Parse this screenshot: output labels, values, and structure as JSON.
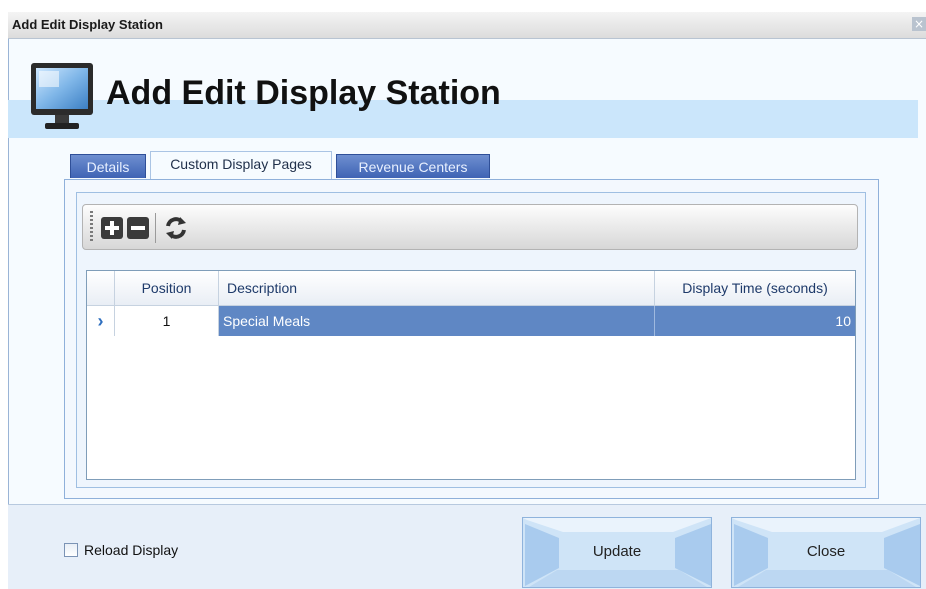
{
  "window": {
    "title": "Add Edit Display Station",
    "close_glyph": "×"
  },
  "header": {
    "icon": "monitor-icon",
    "title": "Add Edit Display Station"
  },
  "tabs": [
    {
      "label": "Details",
      "active": false
    },
    {
      "label": "Custom Display Pages",
      "active": true
    },
    {
      "label": "Revenue Centers",
      "active": false
    }
  ],
  "toolbar": {
    "buttons": [
      {
        "icon": "add-icon"
      },
      {
        "icon": "remove-icon"
      },
      {
        "icon": "refresh-icon"
      }
    ]
  },
  "grid": {
    "columns": [
      "Position",
      "Description",
      "Display Time (seconds)"
    ],
    "rows": [
      {
        "selected": true,
        "indicator": "›",
        "position": "1",
        "description": "Special Meals",
        "display_time": "10"
      }
    ]
  },
  "footer": {
    "reload_display": {
      "label": "Reload Display",
      "checked": false
    },
    "update_label": "Update",
    "close_label": "Close"
  },
  "colors": {
    "selected_row": "#5f87c4",
    "tab_inactive": "#4a6dbd",
    "header_band": "#cbe6fb"
  }
}
